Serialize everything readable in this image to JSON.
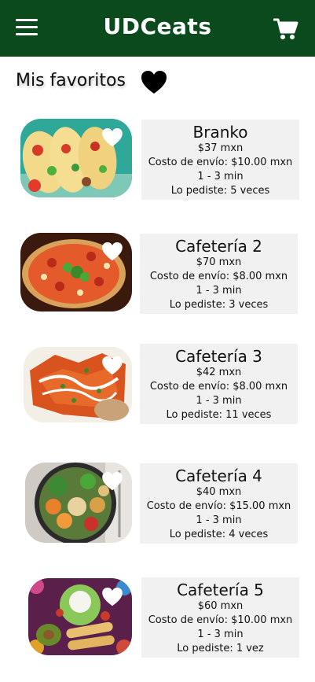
{
  "header": {
    "title": "UDCeats",
    "bg_color": "#0a4a1c",
    "menu_icon": "hamburger-menu-icon",
    "cart_icon": "shopping-cart-icon"
  },
  "favorites": {
    "title": "Mis favoritos",
    "heart_icon": "heart-icon"
  },
  "restaurants": [
    {
      "name": "Branko",
      "price": "$37 mxn",
      "shipping": "Costo de envío: $10.00 mxn",
      "time": "1 - 3 min",
      "ordered": "Lo pediste: 5 veces",
      "image": "tacos"
    },
    {
      "name": "Cafetería 2",
      "price": "$70 mxn",
      "shipping": "Costo de envío: $8.00 mxn",
      "time": "1 - 3 min",
      "ordered": "Lo pediste: 3 veces",
      "image": "pizza"
    },
    {
      "name": "Cafetería 3",
      "price": "$42 mxn",
      "shipping": "Costo de envío: $8.00 mxn",
      "time": "1 - 3 min",
      "ordered": "Lo pediste: 11 veces",
      "image": "chilaquiles"
    },
    {
      "name": "Cafetería 4",
      "price": "$40 mxn",
      "shipping": "Costo de envío: $15.00 mxn",
      "time": "1 - 3 min",
      "ordered": "Lo pediste: 4 veces",
      "image": "salad bowl"
    },
    {
      "name": "Cafetería 5",
      "price": "$60 mxn",
      "shipping": "Costo de envío: $10.00 mxn",
      "time": "1 - 3 min",
      "ordered": "Lo pediste: 1 vez",
      "image": "flautas"
    }
  ]
}
